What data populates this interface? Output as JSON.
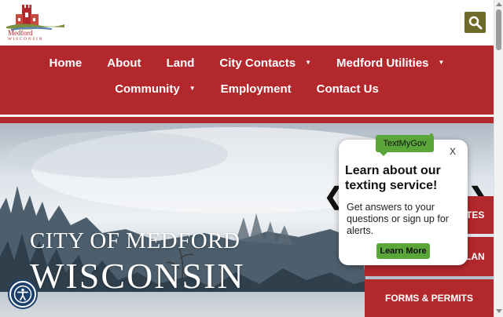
{
  "logo": {
    "name": "Medford",
    "state": "WISCONSIN"
  },
  "header": {
    "search_icon": "search-icon"
  },
  "nav": {
    "row1": [
      {
        "label": "Home",
        "has_dropdown": false
      },
      {
        "label": "About",
        "has_dropdown": false
      },
      {
        "label": "Land",
        "has_dropdown": false
      },
      {
        "label": "City Contacts",
        "has_dropdown": true
      },
      {
        "label": "Medford Utilities",
        "has_dropdown": true
      }
    ],
    "row2": [
      {
        "label": "Community",
        "has_dropdown": true
      },
      {
        "label": "Employment",
        "has_dropdown": false
      },
      {
        "label": "Contact Us",
        "has_dropdown": false
      }
    ]
  },
  "hero": {
    "line1": "CITY OF MEDFORD",
    "line2": "WISCONSIN"
  },
  "carousel": {
    "prev": "❮",
    "next": "❯"
  },
  "quick_links": [
    {
      "label": "TES"
    },
    {
      "label": "LAN"
    },
    {
      "label": "FORMS & PERMITS"
    }
  ],
  "popup": {
    "badge": "TextMyGov",
    "close": "X",
    "title": "Learn about our texting service!",
    "body": "Get answers to your questions or sign up for alerts.",
    "button": "Learn More"
  },
  "colors": {
    "brand_red": "#b3282d",
    "search_olive": "#6d6a2a",
    "popup_green": "#5aa63a",
    "a11y_blue": "#1b3f6b"
  }
}
